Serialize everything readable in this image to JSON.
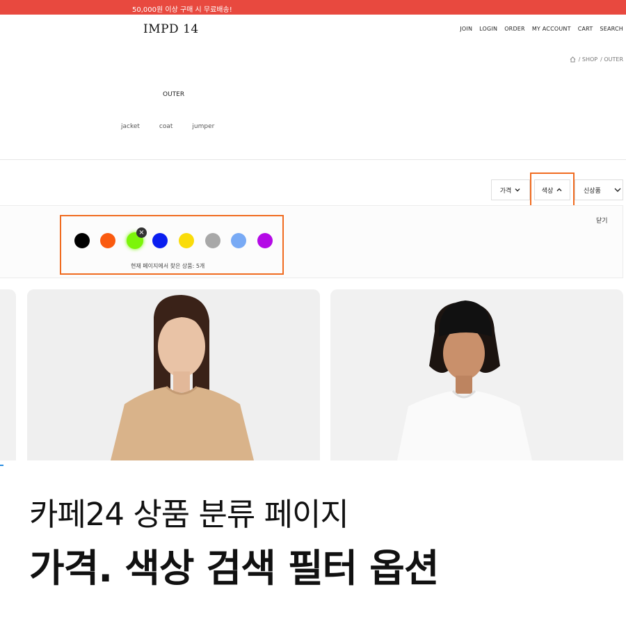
{
  "promo": {
    "text": "50,000원 이상 구매 시 무료배송!"
  },
  "header": {
    "logo": "IMPD 14",
    "nav": [
      "JOIN",
      "LOGIN",
      "ORDER",
      "MY ACCOUNT",
      "CART",
      "SEARCH"
    ]
  },
  "breadcrumb": {
    "items": [
      "/ SHOP",
      "/ OUTER"
    ],
    "home_icon": "home-icon"
  },
  "category": {
    "title": "OUTER",
    "subcategories": [
      "jacket",
      "coat",
      "jumper"
    ]
  },
  "filters": {
    "price_label": "가격",
    "color_label": "색상",
    "sort_label": "신상품",
    "close_label": "닫기",
    "swatches": [
      {
        "name": "black",
        "color": "#000000"
      },
      {
        "name": "orange",
        "color": "#fa5a0f"
      },
      {
        "name": "lime",
        "color": "#7cf50a",
        "selected": true
      },
      {
        "name": "blue",
        "color": "#0a1ef0"
      },
      {
        "name": "yellow",
        "color": "#fadc0a"
      },
      {
        "name": "gray",
        "color": "#a8a8a8"
      },
      {
        "name": "light-blue",
        "color": "#78aaf5"
      },
      {
        "name": "purple",
        "color": "#b40ae6"
      }
    ],
    "result_text": "현재 페이지에서 찾은 상품: 5개",
    "highlight_color": "#f06b1f"
  },
  "caption": {
    "line1": "카페24 상품 분류 페이지",
    "line2": "가격. 색상 검색 필터 옵션"
  }
}
